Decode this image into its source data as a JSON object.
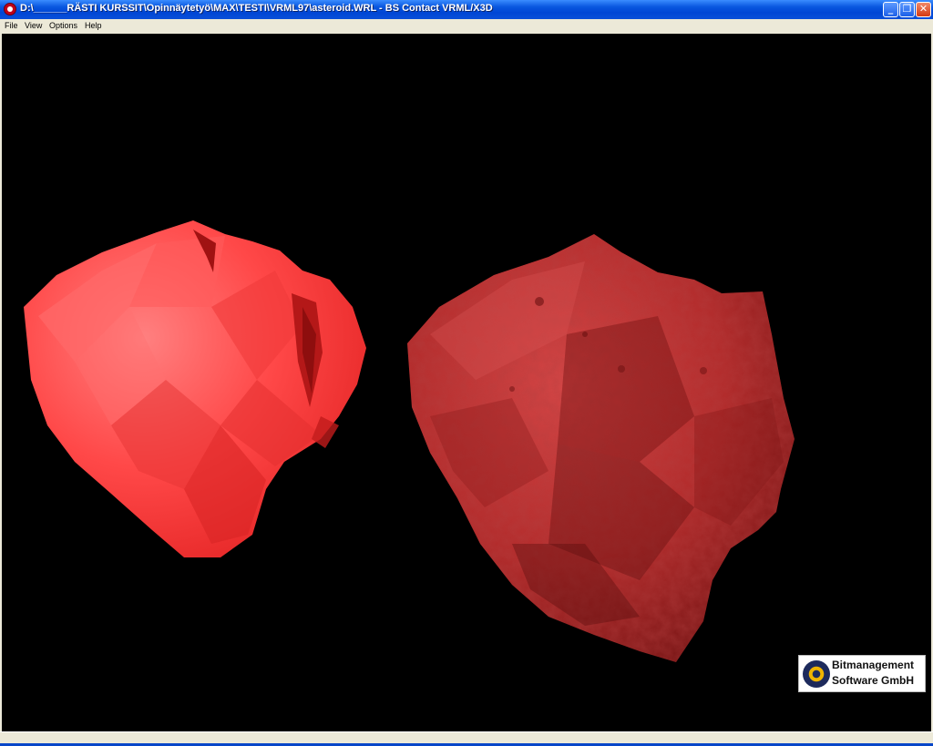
{
  "window": {
    "title": "D:\\______RÄSTI KURSSIT\\Opinnäytetyö\\MAX\\TESTI\\VRML97\\asteroid.WRL - BS Contact VRML/X3D",
    "minimize_glyph": "_",
    "restore_glyph": "❐",
    "close_glyph": "✕"
  },
  "menu": {
    "items": [
      "File",
      "View",
      "Options",
      "Help"
    ]
  },
  "logo": {
    "line1": "Bitmanagement",
    "line2": "Software GmbH"
  },
  "colors": {
    "viewport_bg": "#000000",
    "asteroid_flat": "#ff4a4a",
    "asteroid_textured": "#b02828"
  }
}
